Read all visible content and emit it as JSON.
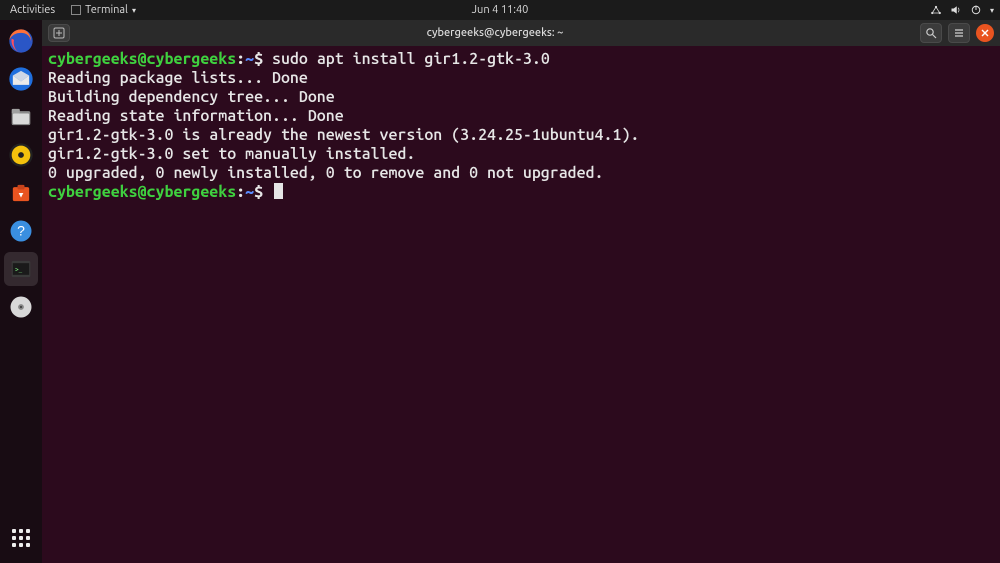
{
  "top_panel": {
    "activities": "Activities",
    "app_menu": "Terminal",
    "clock": "Jun 4  11:40"
  },
  "dock": {
    "items": [
      {
        "name": "firefox-icon"
      },
      {
        "name": "thunderbird-icon"
      },
      {
        "name": "files-icon"
      },
      {
        "name": "rhythmbox-icon"
      },
      {
        "name": "software-icon"
      },
      {
        "name": "help-icon"
      },
      {
        "name": "terminal-icon"
      },
      {
        "name": "disc-icon"
      }
    ]
  },
  "terminal": {
    "title": "cybergeeks@cybergeeks: ~",
    "prompt_user": "cybergeeks@cybergeeks",
    "prompt_sep": ":",
    "prompt_path": "~",
    "prompt_end": "$",
    "command": "sudo apt install gir1.2-gtk-3.0",
    "output": [
      "Reading package lists... Done",
      "Building dependency tree... Done",
      "Reading state information... Done",
      "gir1.2-gtk-3.0 is already the newest version (3.24.25-1ubuntu4.1).",
      "gir1.2-gtk-3.0 set to manually installed.",
      "0 upgraded, 0 newly installed, 0 to remove and 0 not upgraded."
    ]
  }
}
